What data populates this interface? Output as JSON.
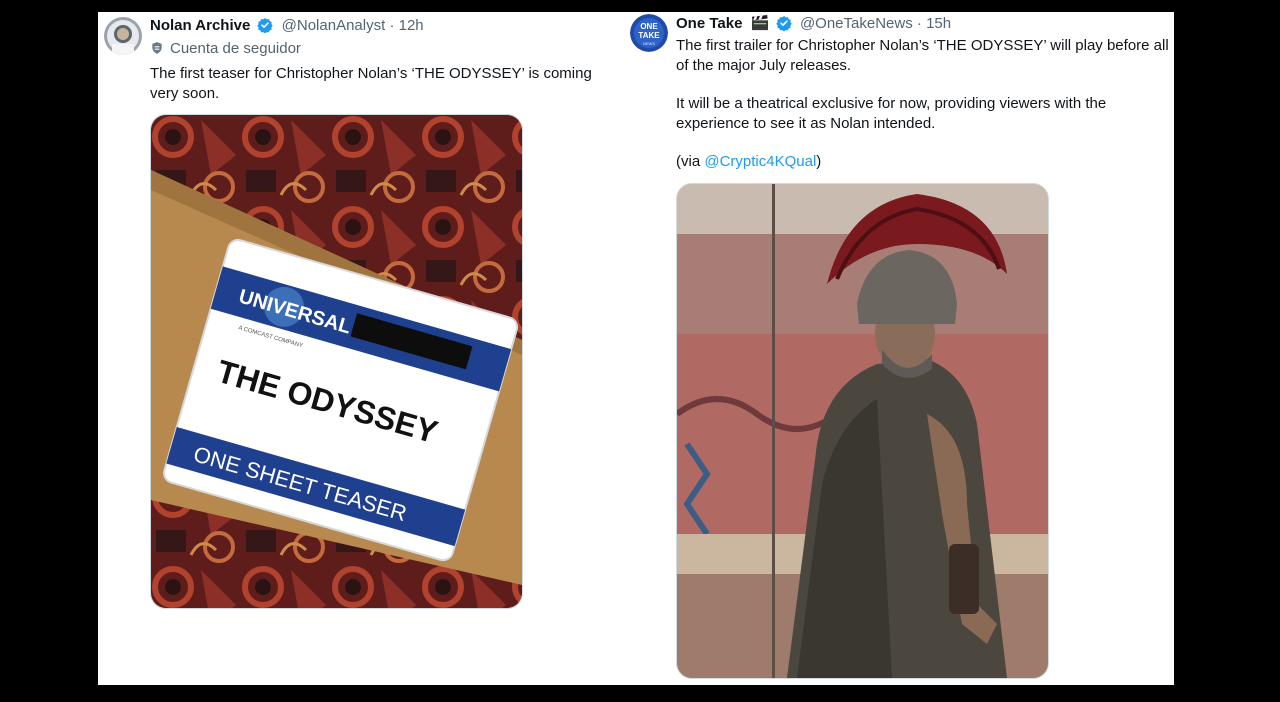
{
  "tweets": [
    {
      "display_name": "Nolan Archive",
      "handle": "@NolanAnalyst",
      "separator": "·",
      "time": "12h",
      "context_label": "Cuenta de seguidor",
      "text": "The first teaser for Christopher Nolan’s ‘THE ODYSSEY’ is coming very soon.",
      "media": {
        "brand": "UNIVERSAL",
        "brand_sub": "A COMCAST COMPANY",
        "label_title": "THE ODYSSEY",
        "label_footer": "ONE SHEET TEASER"
      }
    },
    {
      "display_name": "One Take",
      "handle": "@OneTakeNews",
      "separator": "·",
      "time": "15h",
      "avatar_text_1": "ONE",
      "avatar_text_2": "TAKE",
      "avatar_text_3": "NEWS",
      "paragraph_1": "The first trailer for Christopher Nolan’s ‘THE ODYSSEY’ will play before all of the major July releases.",
      "paragraph_2": "It will be a theatrical exclusive for now, providing viewers with the experience to see it as Nolan intended.",
      "via_prefix": "(via ",
      "via_mention": "@Cryptic4KQual",
      "via_suffix": ")"
    }
  ],
  "colors": {
    "link": "#1d9bf0",
    "verified": "#1d9bf0",
    "secondary_text": "#536471"
  }
}
